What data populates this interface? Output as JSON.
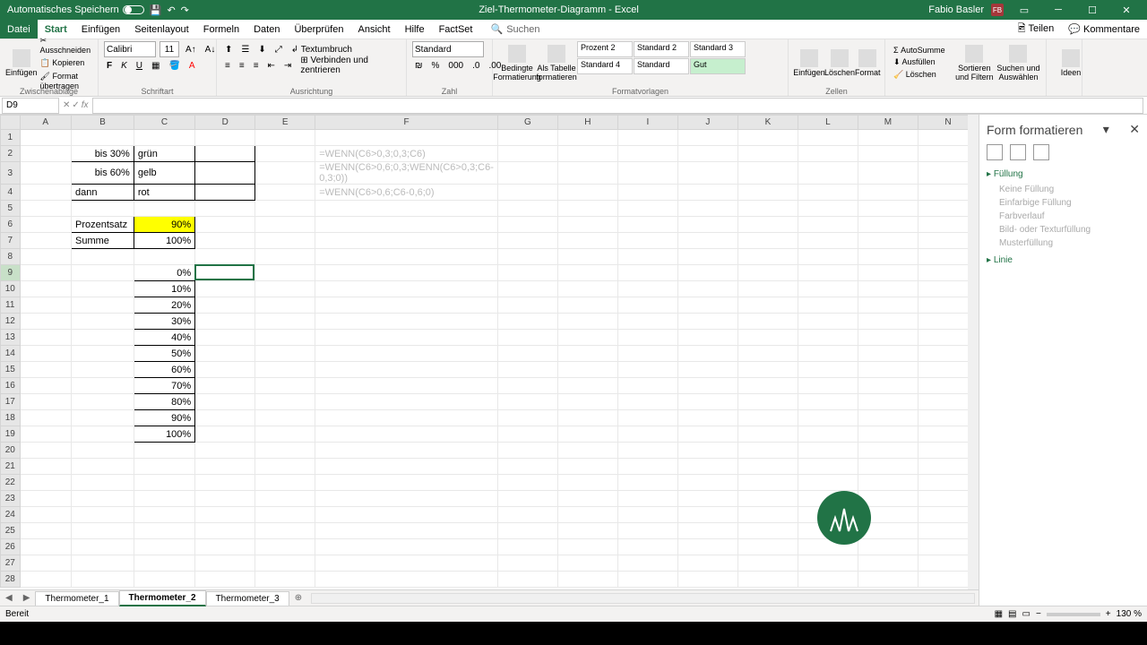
{
  "titlebar": {
    "autosave": "Automatisches Speichern",
    "doc_title": "Ziel-Thermometer-Diagramm - Excel",
    "user": "Fabio Basler",
    "user_initials": "FB"
  },
  "menu": {
    "file": "Datei",
    "start": "Start",
    "einfuegen": "Einfügen",
    "seitenlayout": "Seitenlayout",
    "formeln": "Formeln",
    "daten": "Daten",
    "ueberpruefen": "Überprüfen",
    "ansicht": "Ansicht",
    "hilfe": "Hilfe",
    "factset": "FactSet",
    "suchen": "Suchen",
    "teilen": "Teilen",
    "kommentare": "Kommentare"
  },
  "ribbon": {
    "einfuegen_btn": "Einfügen",
    "ausschneiden": "Ausschneiden",
    "kopieren": "Kopieren",
    "format_uebertragen": "Format übertragen",
    "zwischenablage": "Zwischenablage",
    "font_name": "Calibri",
    "font_size": "11",
    "schriftart": "Schriftart",
    "textumbruch": "Textumbruch",
    "verbinden": "Verbinden und zentrieren",
    "ausrichtung": "Ausrichtung",
    "standard": "Standard",
    "zahl": "Zahl",
    "bedingte": "Bedingte Formatierung",
    "als_tabelle": "Als Tabelle formatieren",
    "prozent2": "Prozent 2",
    "standard2": "Standard 2",
    "standard3": "Standard 3",
    "standard4": "Standard 4",
    "standard_s": "Standard",
    "gut": "Gut",
    "formatvorlagen": "Formatvorlagen",
    "einfuegen2": "Einfügen",
    "loeschen": "Löschen",
    "format": "Format",
    "zellen": "Zellen",
    "autosumme": "AutoSumme",
    "ausfuellen": "Ausfüllen",
    "loeschen2": "Löschen",
    "sortieren": "Sortieren und Filtern",
    "suchen_aus": "Suchen und Auswählen",
    "ideen": "Ideen"
  },
  "namebox": "D9",
  "cells": {
    "B2": "bis 30%",
    "C2": "grün",
    "B3": "bis 60%",
    "C3": "gelb",
    "B4": "dann",
    "C4": "rot",
    "B6": "Prozentsatz",
    "C6": "90%",
    "B7": "Summe",
    "C7": "100%",
    "C9": "0%",
    "C10": "10%",
    "C11": "20%",
    "C12": "30%",
    "C13": "40%",
    "C14": "50%",
    "C15": "60%",
    "C16": "70%",
    "C17": "80%",
    "C18": "90%",
    "C19": "100%",
    "F2": "=WENN(C6>0,3;0,3;C6)",
    "F3": "=WENN(C6>0,6;0,3;WENN(C6>0,3;C6-0,3;0))",
    "F4": "=WENN(C6>0,6;C6-0,6;0)"
  },
  "cols": [
    "A",
    "B",
    "C",
    "D",
    "E",
    "F",
    "G",
    "H",
    "I",
    "J",
    "K",
    "L",
    "M",
    "N"
  ],
  "side": {
    "title": "Form formatieren",
    "fuellung": "Füllung",
    "keine": "Keine Füllung",
    "einfarbig": "Einfarbige Füllung",
    "farbverlauf": "Farbverlauf",
    "bild": "Bild- oder Texturfüllung",
    "muster": "Musterfüllung",
    "linie": "Linie"
  },
  "tabs": {
    "t1": "Thermometer_1",
    "t2": "Thermometer_2",
    "t3": "Thermometer_3"
  },
  "status": {
    "bereit": "Bereit",
    "zoom": "130 %"
  }
}
